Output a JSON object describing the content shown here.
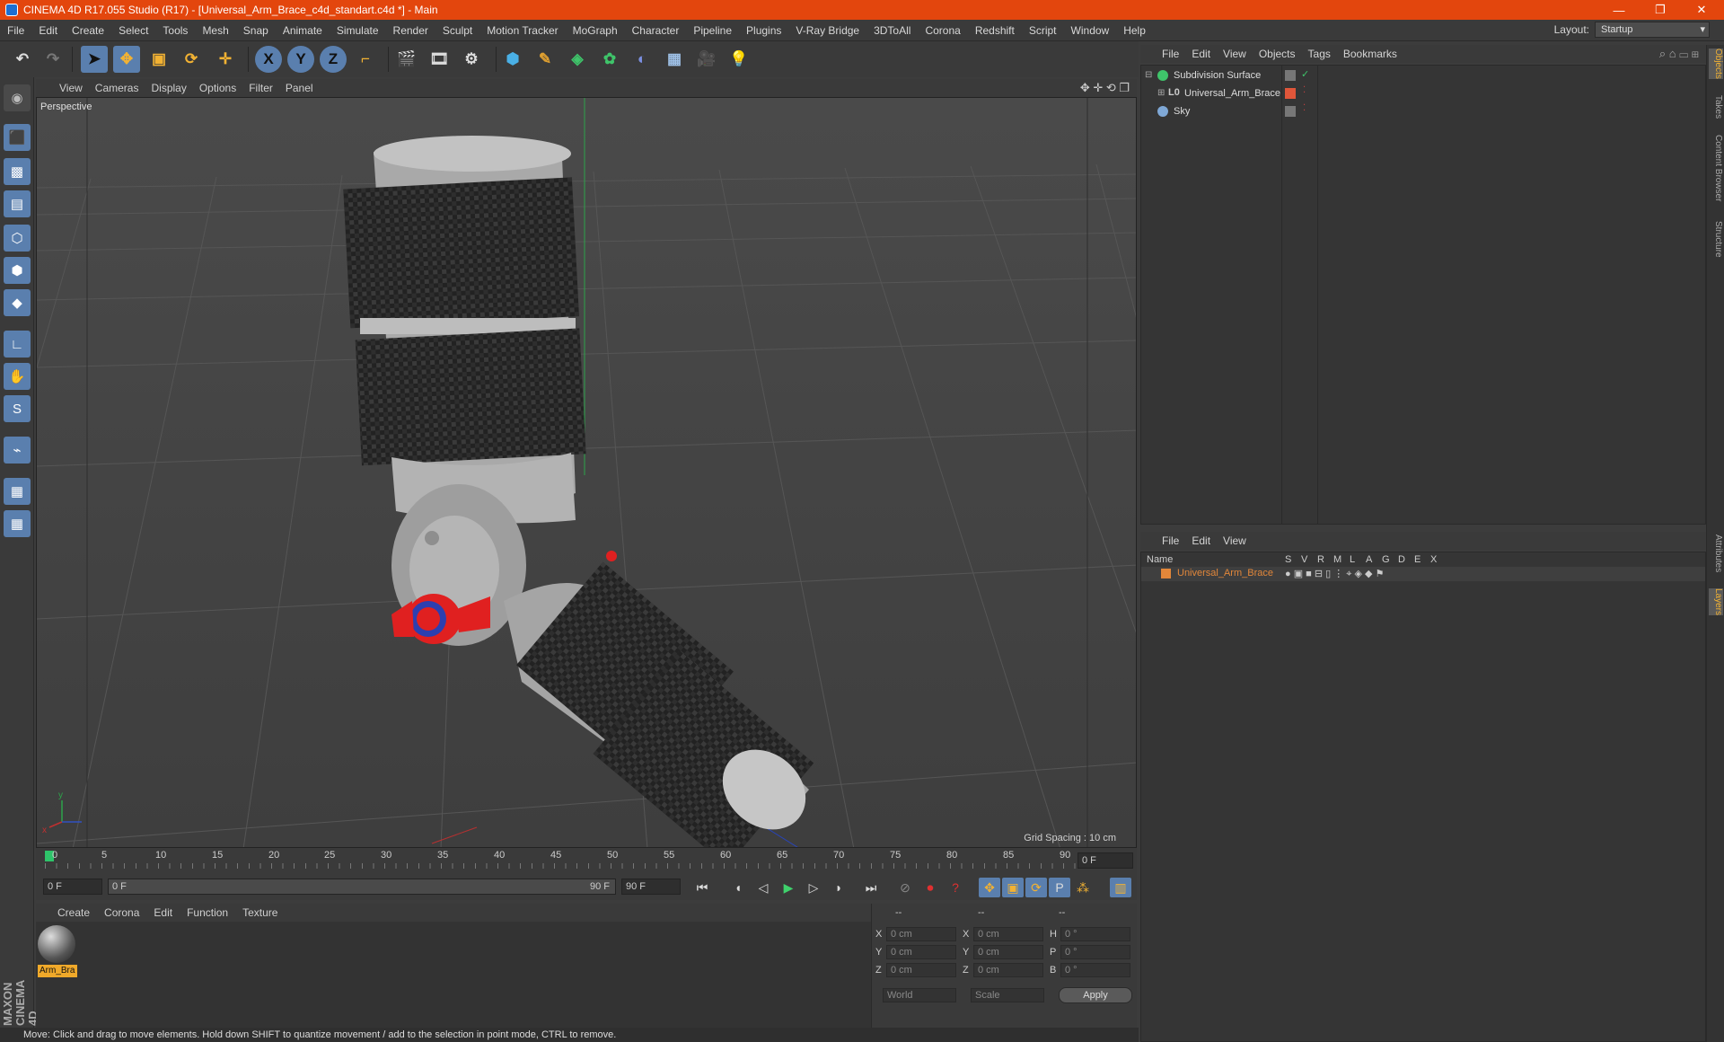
{
  "window": {
    "title": "CINEMA 4D R17.055 Studio (R17) - [Universal_Arm_Brace_c4d_standart.c4d *] - Main"
  },
  "menubar": [
    "File",
    "Edit",
    "Create",
    "Select",
    "Tools",
    "Mesh",
    "Snap",
    "Animate",
    "Simulate",
    "Render",
    "Sculpt",
    "Motion Tracker",
    "MoGraph",
    "Character",
    "Pipeline",
    "Plugins",
    "V-Ray Bridge",
    "3DToAll",
    "Corona",
    "Redshift",
    "Script",
    "Window",
    "Help"
  ],
  "layout": {
    "label": "Layout:",
    "value": "Startup"
  },
  "viewport": {
    "menu": [
      "View",
      "Cameras",
      "Display",
      "Options",
      "Filter",
      "Panel"
    ],
    "label": "Perspective",
    "grid_spacing": "Grid Spacing : 10 cm"
  },
  "timeline": {
    "ticks": [
      "0",
      "5",
      "10",
      "15",
      "20",
      "25",
      "30",
      "35",
      "40",
      "45",
      "50",
      "55",
      "60",
      "65",
      "70",
      "75",
      "80",
      "85",
      "90"
    ],
    "current_frame": "0 F",
    "start_field": "0 F",
    "range_start": "0 F",
    "range_end": "90 F",
    "end_field": "90 F"
  },
  "material_manager": {
    "menu": [
      "Create",
      "Corona",
      "Edit",
      "Function",
      "Texture"
    ],
    "materials": [
      {
        "name": "Arm_Bra"
      }
    ]
  },
  "coordinates": {
    "headers": [
      "--",
      "--",
      "--"
    ],
    "rows": [
      {
        "axis1": "X",
        "val1": "0 cm",
        "axis2": "X",
        "val2": "0 cm",
        "axis3": "H",
        "val3": "0 °"
      },
      {
        "axis1": "Y",
        "val1": "0 cm",
        "axis2": "Y",
        "val2": "0 cm",
        "axis3": "P",
        "val3": "0 °"
      },
      {
        "axis1": "Z",
        "val1": "0 cm",
        "axis2": "Z",
        "val2": "0 cm",
        "axis3": "B",
        "val3": "0 °"
      }
    ],
    "space_select": "World",
    "mode_select": "Scale",
    "apply_label": "Apply"
  },
  "status": "Move: Click and drag to move elements. Hold down SHIFT to quantize movement / add to the selection in point mode, CTRL to remove.",
  "object_manager": {
    "menu": [
      "File",
      "Edit",
      "View",
      "Objects",
      "Tags",
      "Bookmarks"
    ],
    "objects": [
      {
        "name": "Subdivision Surface",
        "color": "#dcdcdc"
      },
      {
        "name": "Universal_Arm_Brace",
        "color": "#dcdcdc"
      },
      {
        "name": "Sky",
        "color": "#dcdcdc"
      }
    ]
  },
  "layer_manager": {
    "menu": [
      "File",
      "Edit",
      "View"
    ],
    "columns": [
      "Name",
      "S",
      "V",
      "R",
      "M",
      "L",
      "A",
      "G",
      "D",
      "E",
      "X"
    ],
    "layers": [
      {
        "name": "Universal_Arm_Brace",
        "color": "#e2873a"
      }
    ]
  },
  "side_tabs": [
    "Objects",
    "Takes",
    "Content Browser",
    "Structure",
    "Attributes",
    "Layers"
  ],
  "brand": "MAXON CINEMA 4D"
}
